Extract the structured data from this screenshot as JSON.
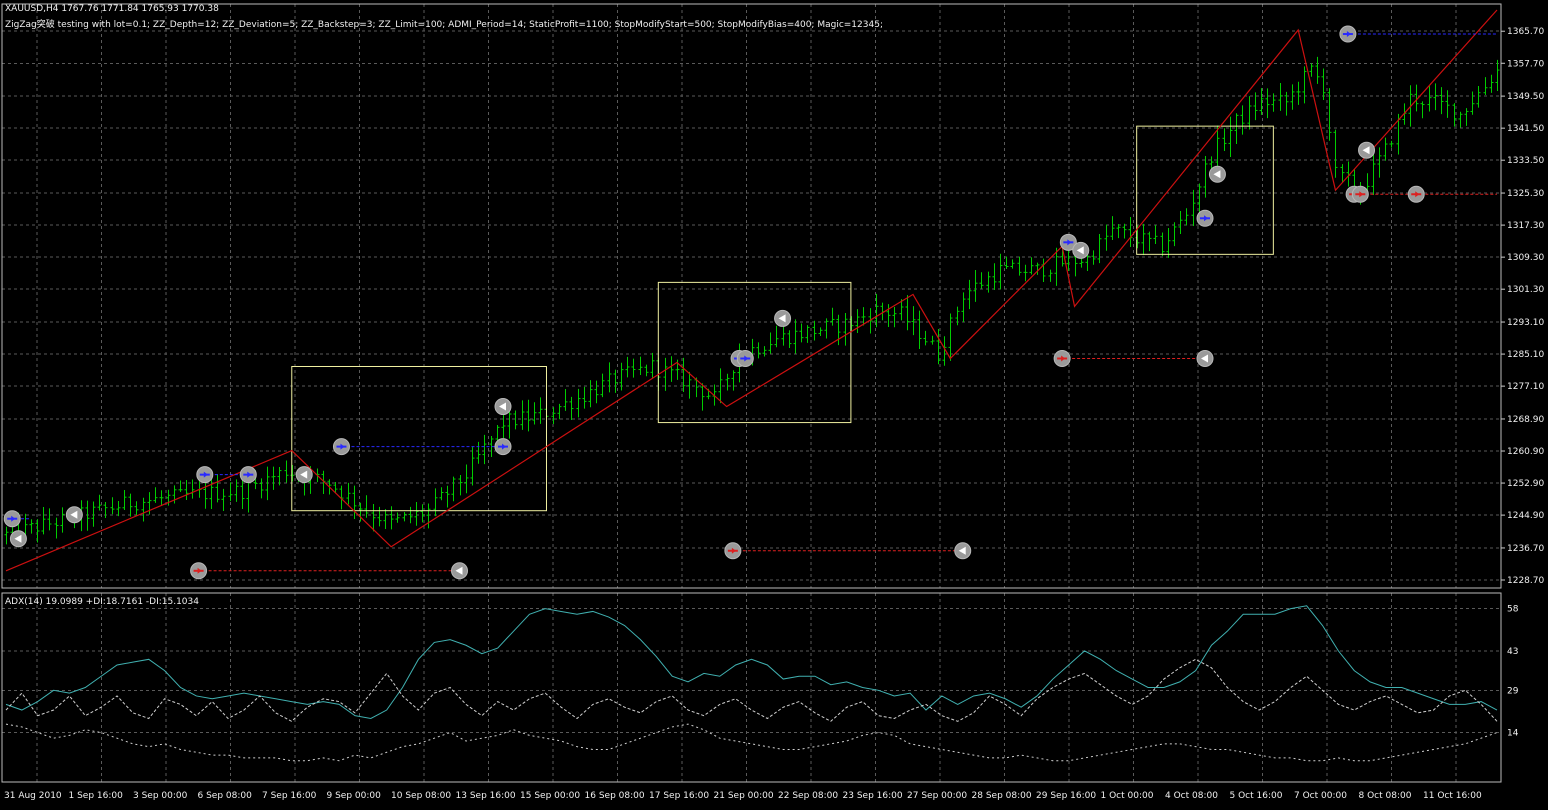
{
  "header": {
    "symbol_line": "XAUUSD,H4  1767.76 1771.84 1765.93 1770.38",
    "ea_line": "ZigZag突破 testing with lot=0.1; ZZ_Depth=12; ZZ_Deviation=5; ZZ_Backstep=3; ZZ_Limit=100; ADMI_Period=14; StaticProfit=1100; StopModifyStart=500; StopModifyBias=400; Magic=12345;"
  },
  "indicator": {
    "label": "ADX(14) 19.0989 +DI:18.7161 -DI:15.1034"
  },
  "colors": {
    "background": "#000000",
    "grid": "#5a5a5a",
    "candles": "#00cc00",
    "zigzag": "#cc1010",
    "boxes": "#f0f0a0",
    "adx": "#40b0b0",
    "di": "#d0d0d0",
    "buy_marker": "#2a2aff",
    "sell_marker": "#dd2020",
    "marker_ring": "#b8b8b8",
    "text": "#f0f0f0"
  },
  "chart_data": [
    {
      "type": "candlestick",
      "title": "XAUUSD,H4",
      "ylim": [
        1228.7,
        1369.0
      ],
      "y_ticks": [
        "1365.70",
        "1357.70",
        "1349.50",
        "1341.50",
        "1333.50",
        "1325.30",
        "1317.30",
        "1309.30",
        "1301.30",
        "1293.10",
        "1285.10",
        "1277.10",
        "1268.90",
        "1260.90",
        "1252.90",
        "1244.90",
        "1236.70",
        "1228.70"
      ],
      "x_ticks": [
        "31 Aug 2010",
        "1 Sep 16:00",
        "3 Sep 00:00",
        "6 Sep 08:00",
        "7 Sep 16:00",
        "9 Sep 00:00",
        "10 Sep 08:00",
        "13 Sep 16:00",
        "15 Sep 00:00",
        "16 Sep 08:00",
        "17 Sep 16:00",
        "21 Sep 00:00",
        "22 Sep 08:00",
        "23 Sep 16:00",
        "27 Sep 00:00",
        "28 Sep 08:00",
        "29 Sep 16:00",
        "1 Oct 00:00",
        "4 Oct 08:00",
        "5 Oct 16:00",
        "7 Oct 00:00",
        "8 Oct 08:00",
        "11 Oct 16:00"
      ],
      "trend_anchors": [
        [
          0,
          1240
        ],
        [
          10,
          1244
        ],
        [
          20,
          1248
        ],
        [
          30,
          1250
        ],
        [
          38,
          1251
        ],
        [
          45,
          1256
        ],
        [
          52,
          1253
        ],
        [
          58,
          1246
        ],
        [
          62,
          1243
        ],
        [
          68,
          1246
        ],
        [
          74,
          1255
        ],
        [
          80,
          1268
        ],
        [
          86,
          1270
        ],
        [
          92,
          1274
        ],
        [
          98,
          1279
        ],
        [
          104,
          1282
        ],
        [
          110,
          1278
        ],
        [
          114,
          1274
        ],
        [
          118,
          1285
        ],
        [
          124,
          1289
        ],
        [
          130,
          1291
        ],
        [
          136,
          1293
        ],
        [
          140,
          1296
        ],
        [
          144,
          1295
        ],
        [
          148,
          1289
        ],
        [
          150,
          1285
        ],
        [
          154,
          1300
        ],
        [
          160,
          1306
        ],
        [
          166,
          1306
        ],
        [
          170,
          1308
        ],
        [
          174,
          1309
        ],
        [
          178,
          1316
        ],
        [
          182,
          1314
        ],
        [
          186,
          1312
        ],
        [
          190,
          1320
        ],
        [
          194,
          1335
        ],
        [
          198,
          1343
        ],
        [
          202,
          1348
        ],
        [
          206,
          1348
        ],
        [
          210,
          1356
        ],
        [
          212,
          1352
        ],
        [
          214,
          1330
        ],
        [
          218,
          1326
        ],
        [
          222,
          1336
        ],
        [
          226,
          1349
        ],
        [
          230,
          1348
        ],
        [
          234,
          1345
        ],
        [
          238,
          1352
        ],
        [
          240,
          1356
        ]
      ],
      "series": [
        {
          "name": "ZigZag",
          "points": [
            [
              0,
              1231
            ],
            [
              46,
              1261
            ],
            [
              62,
              1237
            ],
            [
              108,
              1283
            ],
            [
              116,
              1272
            ],
            [
              146,
              1300
            ],
            [
              152,
              1284
            ],
            [
              170,
              1312
            ],
            [
              172,
              1297
            ],
            [
              208,
              1366
            ],
            [
              214,
              1326
            ],
            [
              240,
              1371
            ]
          ]
        }
      ],
      "boxes": [
        {
          "x0": 46,
          "x1": 87,
          "y0": 1246,
          "y1": 1282
        },
        {
          "x0": 105,
          "x1": 136,
          "y0": 1268,
          "y1": 1303
        },
        {
          "x0": 182,
          "x1": 204,
          "y0": 1310,
          "y1": 1342
        }
      ],
      "order_markers": [
        {
          "x": 1,
          "y": 1244,
          "kind": "buy"
        },
        {
          "x": 2,
          "y": 1239,
          "kind": "close"
        },
        {
          "x": 11,
          "y": 1245,
          "kind": "close"
        },
        {
          "x": 32,
          "y": 1255,
          "kind": "buy"
        },
        {
          "x": 39,
          "y": 1255,
          "kind": "buy"
        },
        {
          "x": 48,
          "y": 1255,
          "kind": "close"
        },
        {
          "x": 54,
          "y": 1262,
          "kind": "buy"
        },
        {
          "x": 80,
          "y": 1262,
          "kind": "buy"
        },
        {
          "x": 80,
          "y": 1272,
          "kind": "close"
        },
        {
          "x": 118,
          "y": 1284,
          "kind": "buy"
        },
        {
          "x": 119,
          "y": 1284,
          "kind": "buy"
        },
        {
          "x": 125,
          "y": 1294,
          "kind": "close"
        },
        {
          "x": 171,
          "y": 1313,
          "kind": "buy"
        },
        {
          "x": 173,
          "y": 1311,
          "kind": "close"
        },
        {
          "x": 193,
          "y": 1319,
          "kind": "buy"
        },
        {
          "x": 195,
          "y": 1330,
          "kind": "close"
        },
        {
          "x": 216,
          "y": 1365,
          "kind": "buy"
        },
        {
          "x": 217,
          "y": 1325,
          "kind": "sell"
        },
        {
          "x": 218,
          "y": 1325,
          "kind": "sell"
        },
        {
          "x": 219,
          "y": 1336,
          "kind": "close"
        },
        {
          "x": 227,
          "y": 1325,
          "kind": "sell"
        },
        {
          "x": 31,
          "y": 1231,
          "kind": "sell"
        },
        {
          "x": 73,
          "y": 1231,
          "kind": "close"
        },
        {
          "x": 117,
          "y": 1236,
          "kind": "sell"
        },
        {
          "x": 154,
          "y": 1236,
          "kind": "close"
        },
        {
          "x": 170,
          "y": 1284,
          "kind": "sell"
        },
        {
          "x": 193,
          "y": 1284,
          "kind": "close"
        }
      ],
      "order_lines": [
        {
          "x0": 0,
          "x1": 4,
          "y": 1244,
          "kind": "buy"
        },
        {
          "x0": 32,
          "x1": 39,
          "y": 1255,
          "kind": "buy"
        },
        {
          "x0": 54,
          "x1": 80,
          "y": 1262,
          "kind": "buy"
        },
        {
          "x0": 118,
          "x1": 119,
          "y": 1284,
          "kind": "buy"
        },
        {
          "x0": 216,
          "x1": 240,
          "y": 1365,
          "kind": "buy"
        },
        {
          "x0": 31,
          "x1": 73,
          "y": 1231,
          "kind": "sell"
        },
        {
          "x0": 117,
          "x1": 154,
          "y": 1236,
          "kind": "sell"
        },
        {
          "x0": 170,
          "x1": 193,
          "y": 1284,
          "kind": "sell"
        },
        {
          "x0": 218,
          "x1": 240,
          "y": 1325,
          "kind": "sell"
        }
      ]
    },
    {
      "type": "line",
      "title": "ADX(14) 19.0989 +DI:18.7161 -DI:15.1034",
      "ylim": [
        0,
        60
      ],
      "y_ticks": [
        "58",
        "43",
        "29",
        "14"
      ],
      "x_ticks": [
        "31 Aug 2010",
        "1 Sep 16:00",
        "3 Sep 00:00",
        "6 Sep 08:00",
        "7 Sep 16:00",
        "9 Sep 00:00",
        "10 Sep 08:00",
        "13 Sep 16:00",
        "15 Sep 00:00",
        "16 Sep 08:00",
        "17 Sep 16:00",
        "21 Sep 00:00",
        "22 Sep 08:00",
        "23 Sep 16:00",
        "27 Sep 00:00",
        "28 Sep 08:00",
        "29 Sep 16:00",
        "1 Oct 00:00",
        "4 Oct 08:00",
        "5 Oct 16:00",
        "7 Oct 00:00",
        "8 Oct 08:00",
        "11 Oct 16:00"
      ],
      "series": [
        {
          "name": "ADX(14)",
          "values": [
            24,
            22,
            25,
            29,
            28,
            30,
            34,
            38,
            39,
            40,
            36,
            30,
            27,
            26,
            27,
            28,
            27,
            26,
            25,
            24,
            25,
            24,
            20,
            19,
            22,
            30,
            40,
            46,
            47,
            45,
            42,
            44,
            50,
            56,
            58,
            57,
            56,
            57,
            55,
            52,
            47,
            41,
            34,
            32,
            35,
            34,
            38,
            40,
            38,
            33,
            34,
            34,
            31,
            32,
            30,
            29,
            27,
            28,
            22,
            27,
            24,
            27,
            28,
            26,
            23,
            27,
            33,
            38,
            43,
            40,
            36,
            33,
            30,
            30,
            32,
            36,
            45,
            50,
            56,
            56,
            56,
            58,
            59,
            52,
            43,
            36,
            32,
            30,
            30,
            28,
            26,
            24,
            24,
            25,
            22
          ]
        },
        {
          "name": "+DI",
          "values": [
            22,
            28,
            20,
            22,
            27,
            20,
            23,
            27,
            21,
            19,
            26,
            24,
            20,
            25,
            19,
            22,
            27,
            21,
            18,
            23,
            26,
            25,
            21,
            28,
            35,
            27,
            22,
            28,
            30,
            24,
            20,
            25,
            22,
            26,
            28,
            23,
            19,
            24,
            26,
            23,
            21,
            25,
            27,
            22,
            20,
            24,
            26,
            22,
            19,
            23,
            25,
            21,
            18,
            23,
            25,
            20,
            19,
            22,
            24,
            20,
            18,
            21,
            27,
            24,
            20,
            26,
            30,
            33,
            35,
            31,
            27,
            24,
            27,
            33,
            37,
            40,
            37,
            30,
            25,
            22,
            25,
            30,
            34,
            29,
            24,
            22,
            25,
            27,
            24,
            21,
            22,
            27,
            29,
            24,
            18
          ]
        },
        {
          "name": "-DI",
          "values": [
            17,
            16,
            14,
            12,
            13,
            15,
            14,
            12,
            10,
            9,
            10,
            8,
            7,
            6,
            6,
            5,
            5,
            5,
            4,
            4,
            5,
            4,
            6,
            5,
            7,
            9,
            10,
            12,
            14,
            11,
            12,
            13,
            15,
            13,
            12,
            11,
            9,
            8,
            8,
            10,
            12,
            14,
            16,
            17,
            15,
            12,
            11,
            10,
            9,
            8,
            8,
            9,
            10,
            11,
            13,
            14,
            13,
            10,
            9,
            8,
            7,
            6,
            5,
            5,
            6,
            5,
            4,
            4,
            5,
            6,
            7,
            8,
            9,
            10,
            10,
            9,
            8,
            8,
            7,
            6,
            5,
            5,
            4,
            4,
            5,
            4,
            4,
            5,
            6,
            7,
            8,
            9,
            10,
            12,
            14
          ]
        }
      ]
    }
  ]
}
